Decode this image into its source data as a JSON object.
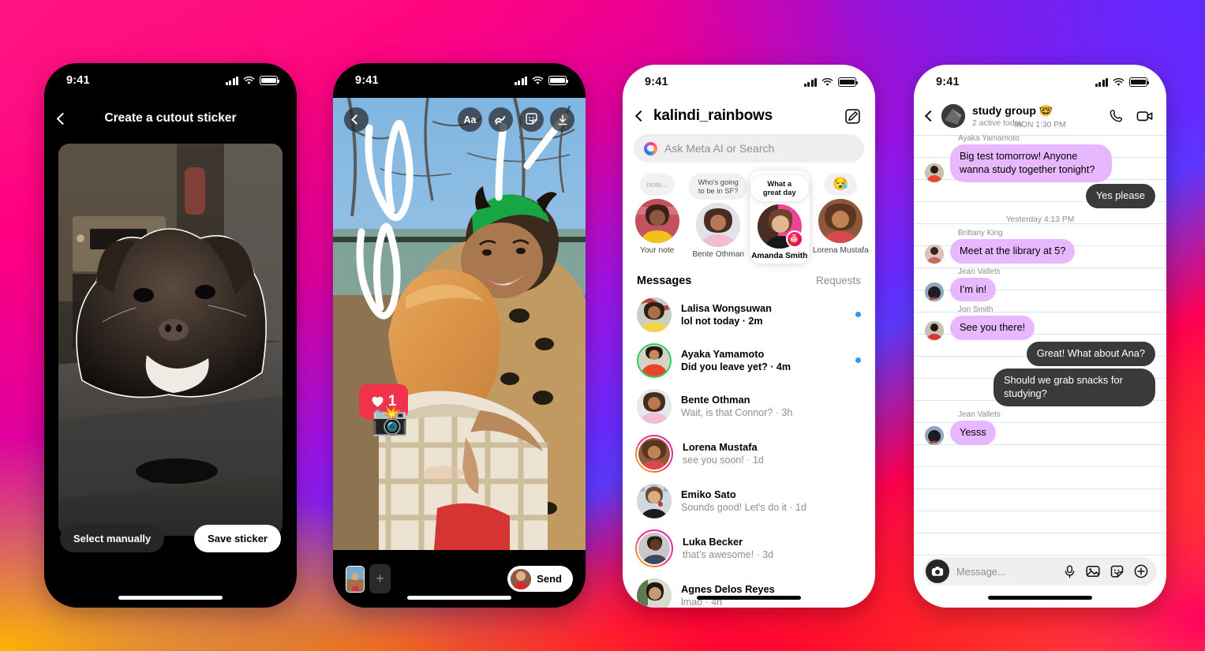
{
  "background": {
    "colors": [
      "#ff1a8c",
      "#9b15e8",
      "#5b3bff",
      "#ff2b2b",
      "#ffb400"
    ]
  },
  "phone1": {
    "status": {
      "time": "9:41"
    },
    "header": {
      "back_icon": "chevron-left-icon",
      "title": "Create a cutout sticker"
    },
    "photo": {
      "description": "French bulldog cutout with white outline"
    },
    "buttons": {
      "select_manually": "Select manually",
      "save_sticker": "Save sticker"
    }
  },
  "phone2": {
    "status": {
      "time": "9:41"
    },
    "tools": [
      {
        "name": "back-button",
        "icon": "chevron-left-icon",
        "label": ""
      },
      {
        "name": "text-tool",
        "icon": "text-icon",
        "label": "Aa"
      },
      {
        "name": "draw-tool",
        "icon": "squiggle-icon",
        "label": ""
      },
      {
        "name": "sticker-tool",
        "icon": "sticker-icon",
        "label": ""
      },
      {
        "name": "download-button",
        "icon": "download-icon",
        "label": ""
      }
    ],
    "overlay": {
      "like_count": "1",
      "camera_emoji": "camera-flash-emoji"
    },
    "bottom": {
      "add_label": "+",
      "send_label": "Send"
    }
  },
  "phone3": {
    "status": {
      "time": "9:41"
    },
    "header": {
      "back_icon": "chevron-left-icon",
      "title": "kalindi_rainbows",
      "compose_icon": "compose-icon"
    },
    "search": {
      "placeholder": "Ask Meta AI or Search",
      "icon": "meta-ai-icon"
    },
    "notes": [
      {
        "bubble": "note...",
        "label": "Your note",
        "active": false,
        "ring": false,
        "emoji": false
      },
      {
        "bubble": "Who's going to be in SF?",
        "label": "Bente Othman",
        "active": false,
        "ring": true,
        "emoji": false
      },
      {
        "bubble": "What a great day",
        "label": "Amanda Smith",
        "active": true,
        "ring": false,
        "emoji": false,
        "badge": "birthday-cake-icon"
      },
      {
        "bubble": "😪",
        "label": "Lorena Mustafa",
        "active": false,
        "ring": false,
        "emoji": true
      }
    ],
    "messages_header": {
      "title": "Messages",
      "requests": "Requests"
    },
    "threads": [
      {
        "name": "Lalisa Wongsuwan",
        "preview": "lol not today · 2m",
        "unread": true,
        "ring": "none"
      },
      {
        "name": "Ayaka Yamamoto",
        "preview": "Did you leave yet? · 4m",
        "unread": true,
        "ring": "green"
      },
      {
        "name": "Bente Othman",
        "preview": "Wait, is that Connor? · 3h",
        "unread": false,
        "ring": "none"
      },
      {
        "name": "Lorena Mustafa",
        "preview": "see you soon! · 1d",
        "unread": false,
        "ring": "gradient"
      },
      {
        "name": "Emiko Sato",
        "preview": "Sounds good! Let’s do it · 1d",
        "unread": false,
        "ring": "none"
      },
      {
        "name": "Luka Becker",
        "preview": "that’s awesome! · 3d",
        "unread": false,
        "ring": "gradient"
      },
      {
        "name": "Agnes Delos Reyes",
        "preview": "lmao · 4h",
        "unread": false,
        "ring": "none"
      }
    ]
  },
  "phone4": {
    "status": {
      "time": "9:41"
    },
    "header": {
      "back_icon": "chevron-left-icon",
      "name": "study group 🤓",
      "subtitle": "2 active today",
      "call_icon": "phone-icon",
      "video_icon": "video-camera-icon"
    },
    "chat": [
      {
        "type": "timestamp",
        "text": "MON 1:30 PM"
      },
      {
        "type": "sender",
        "text": "Ayaka Yamamoto"
      },
      {
        "type": "incoming",
        "text": "Big test tomorrow! Anyone wanna study together tonight?"
      },
      {
        "type": "outgoing",
        "text": "Yes please"
      },
      {
        "type": "timestamp",
        "text": "Yesterday 4:13 PM"
      },
      {
        "type": "sender",
        "text": "Brittany King"
      },
      {
        "type": "incoming",
        "text": "Meet at the library at 5?"
      },
      {
        "type": "sender",
        "text": "Jean Vallets"
      },
      {
        "type": "incoming",
        "text": "I’m in!"
      },
      {
        "type": "sender",
        "text": "Jon Smith"
      },
      {
        "type": "incoming",
        "text": "See you there!"
      },
      {
        "type": "outgoing",
        "text": "Great! What about Ana?"
      },
      {
        "type": "outgoing",
        "text": "Should we grab snacks for studying?"
      },
      {
        "type": "sender",
        "text": "Jean Vallets"
      },
      {
        "type": "incoming",
        "text": "Yesss"
      }
    ],
    "composer": {
      "placeholder": "Message...",
      "camera_icon": "camera-icon",
      "icons": [
        "microphone-icon",
        "photo-icon",
        "sticker-icon",
        "plus-circle-icon"
      ]
    }
  }
}
